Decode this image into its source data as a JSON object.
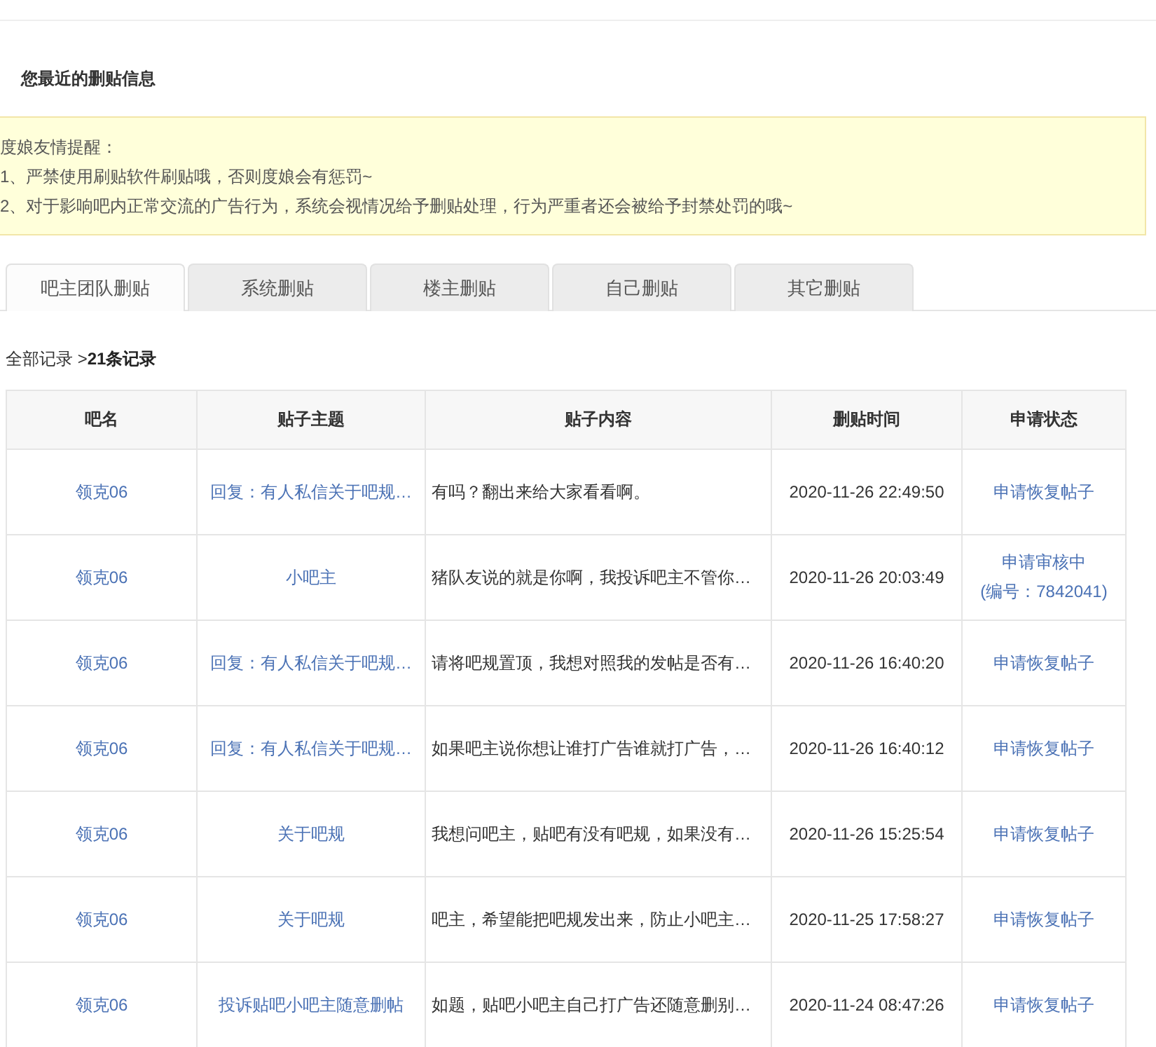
{
  "heading": "您最近的删贴信息",
  "notice": {
    "title": "度娘友情提醒：",
    "lines": [
      "1、严禁使用刷贴软件刷贴哦，否则度娘会有惩罚~",
      "2、对于影响吧内正常交流的广告行为，系统会视情况给予删贴处理，行为严重者还会被给予封禁处罚的哦~"
    ]
  },
  "tabs": [
    {
      "label": "吧主团队删贴",
      "selected": true
    },
    {
      "label": "系统删贴",
      "selected": false
    },
    {
      "label": "楼主删贴",
      "selected": false
    },
    {
      "label": "自己删贴",
      "selected": false
    },
    {
      "label": "其它删贴",
      "selected": false
    }
  ],
  "breadcrumb": {
    "all": "全部记录 >",
    "count": "21条记录"
  },
  "table": {
    "columns": [
      "吧名",
      "贴子主题",
      "贴子内容",
      "删贴时间",
      "申请状态"
    ],
    "rows": [
      {
        "bar": "领克06",
        "topic": "回复：有人私信关于吧规…",
        "content": "有吗？翻出来给大家看看啊。",
        "time": "2020-11-26 22:49:50",
        "status": {
          "kind": "link",
          "lines": [
            "申请恢复帖子"
          ]
        }
      },
      {
        "bar": "领克06",
        "topic": "小吧主",
        "content": "猪队友说的就是你啊，我投诉吧主不管你…",
        "time": "2020-11-26 20:03:49",
        "status": {
          "kind": "pending",
          "lines": [
            "申请审核中",
            "(编号：7842041)"
          ]
        }
      },
      {
        "bar": "领克06",
        "topic": "回复：有人私信关于吧规…",
        "content": "请将吧规置顶，我想对照我的发帖是否有…",
        "time": "2020-11-26 16:40:20",
        "status": {
          "kind": "link",
          "lines": [
            "申请恢复帖子"
          ]
        }
      },
      {
        "bar": "领克06",
        "topic": "回复：有人私信关于吧规…",
        "content": "如果吧主说你想让谁打广告谁就打广告，…",
        "time": "2020-11-26 16:40:12",
        "status": {
          "kind": "link",
          "lines": [
            "申请恢复帖子"
          ]
        }
      },
      {
        "bar": "领克06",
        "topic": "关于吧规",
        "content": "我想问吧主，贴吧有没有吧规，如果没有…",
        "time": "2020-11-26 15:25:54",
        "status": {
          "kind": "link",
          "lines": [
            "申请恢复帖子"
          ]
        }
      },
      {
        "bar": "领克06",
        "topic": "关于吧规",
        "content": "吧主，希望能把吧规发出来，防止小吧主…",
        "time": "2020-11-25 17:58:27",
        "status": {
          "kind": "link",
          "lines": [
            "申请恢复帖子"
          ]
        }
      },
      {
        "bar": "领克06",
        "topic": "投诉贴吧小吧主随意删帖",
        "content": "如题，贴吧小吧主自己打广告还随意删别…",
        "time": "2020-11-24 08:47:26",
        "status": {
          "kind": "link",
          "lines": [
            "申请恢复帖子"
          ]
        }
      }
    ]
  }
}
